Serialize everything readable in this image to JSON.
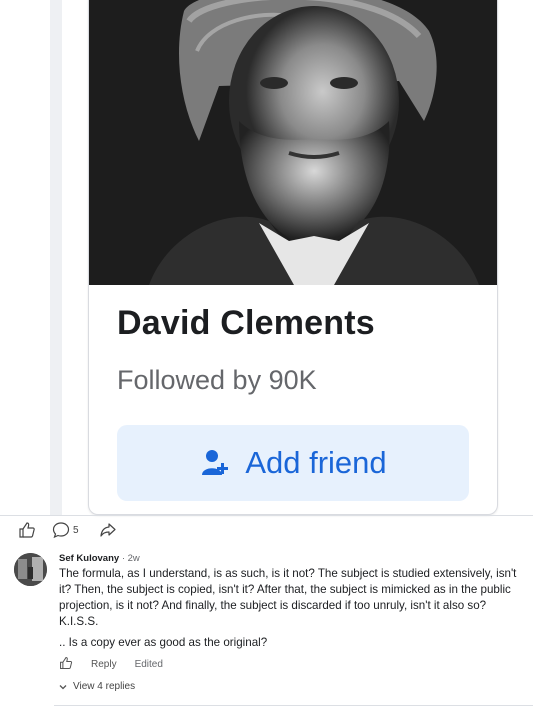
{
  "card": {
    "name": "David Clements",
    "followers": "Followed by 90K",
    "add_friend_label": "Add friend"
  },
  "post_actions": {
    "comment_count": "5"
  },
  "comment": {
    "author": "Sef Kulovany",
    "separator": " · ",
    "time": "2w",
    "body": "The formula, as I understand, is as such, is it not? The subject is studied extensively, isn't it? Then, the subject is copied, isn't it? After that, the subject is mimicked as in the public projection, is it not? And finally, the subject is discarded if too unruly, isn't it also so? K.I.S.S.",
    "body2": ".. Is a copy ever as good as the original?",
    "reply_label": "Reply",
    "edited_label": "Edited"
  },
  "replies": {
    "view_label": "View 4 replies"
  },
  "colors": {
    "accent": "#1a66d8",
    "button_bg": "#e7f1fd",
    "text": "#1c1e21",
    "muted": "#65676b"
  }
}
